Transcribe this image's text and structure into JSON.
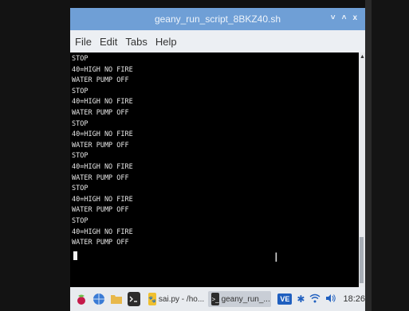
{
  "window": {
    "title": "geany_run_script_8BKZ40.sh"
  },
  "window_controls": {
    "minimize": "˅",
    "maximize": "˄",
    "close": "x"
  },
  "menu": [
    "File",
    "Edit",
    "Tabs",
    "Help"
  ],
  "terminal": {
    "lines": [
      "STOP",
      "40=HIGH NO FIRE",
      "WATER PUMP OFF",
      "STOP",
      "40=HIGH NO FIRE",
      "WATER PUMP OFF",
      "STOP",
      "40=HIGH NO FIRE",
      "WATER PUMP OFF",
      "STOP",
      "40=HIGH NO FIRE",
      "WATER PUMP OFF",
      "STOP",
      "40=HIGH NO FIRE",
      "WATER PUMP OFF",
      "STOP",
      "40=HIGH NO FIRE",
      "WATER PUMP OFF"
    ]
  },
  "taskbar": {
    "tasks": [
      {
        "label": "sai.py - /ho...",
        "icon": "geany-icon"
      },
      {
        "label": "geany_run_...",
        "icon": "terminal-icon",
        "active": true
      }
    ],
    "tray_extra": "VE",
    "clock": "18:26"
  },
  "colors": {
    "titlebar": "#6f9fd6",
    "terminal_bg": "#000000",
    "terminal_fg": "#e6e6e6",
    "taskbar": "#e8ebef"
  }
}
